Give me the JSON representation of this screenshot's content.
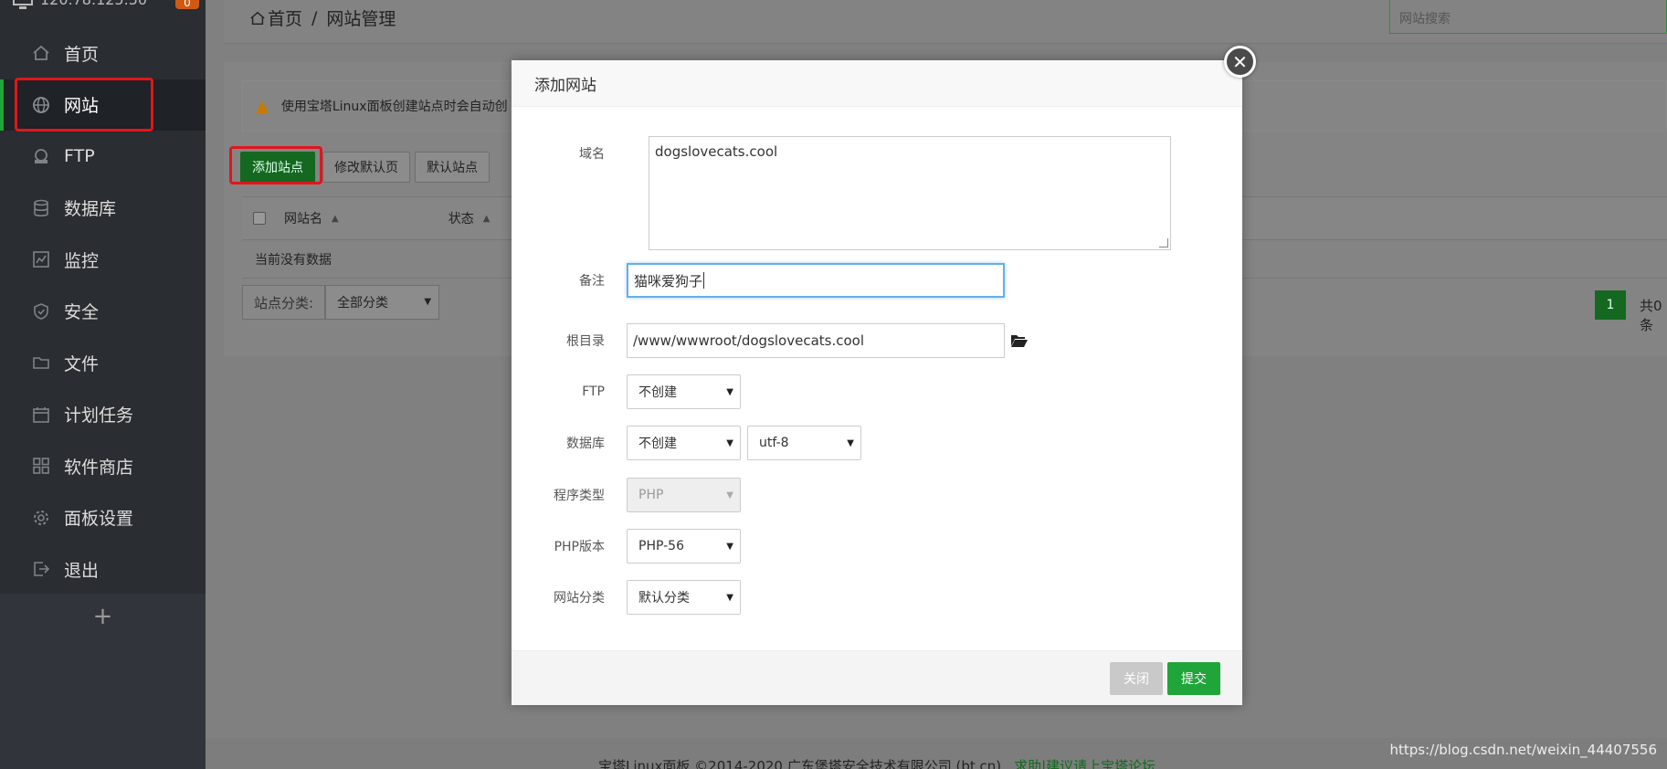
{
  "sidebar": {
    "server_ip": "120.78.125.50",
    "badge": "0",
    "items": [
      {
        "label": "首页",
        "icon": "home-icon"
      },
      {
        "label": "网站",
        "icon": "globe-icon"
      },
      {
        "label": "FTP",
        "icon": "ftp-icon"
      },
      {
        "label": "数据库",
        "icon": "database-icon"
      },
      {
        "label": "监控",
        "icon": "monitor-icon"
      },
      {
        "label": "安全",
        "icon": "shield-icon"
      },
      {
        "label": "文件",
        "icon": "folder-icon"
      },
      {
        "label": "计划任务",
        "icon": "calendar-icon"
      },
      {
        "label": "软件商店",
        "icon": "grid-icon"
      },
      {
        "label": "面板设置",
        "icon": "gear-icon"
      },
      {
        "label": "退出",
        "icon": "logout-icon"
      }
    ],
    "active_item": "网站",
    "add_symbol": "+"
  },
  "header": {
    "breadcrumb_home": "首页",
    "breadcrumb_sep": "/",
    "breadcrumb_current": "网站管理",
    "search_placeholder": "网站搜索"
  },
  "main": {
    "notice": "使用宝塔Linux面板创建站点时会自动创",
    "buttons": {
      "add_site": "添加站点",
      "edit_default_page": "修改默认页",
      "default_site": "默认站点"
    },
    "table": {
      "col_name": "网站名",
      "col_status": "状态",
      "empty": "当前没有数据"
    },
    "category_label": "站点分类:",
    "category_value": "全部分类",
    "page_current": "1",
    "page_total": "共0条"
  },
  "modal": {
    "title": "添加网站",
    "fields": {
      "domain_label": "域名",
      "domain_value": "dogslovecats.cool",
      "remark_label": "备注",
      "remark_value": "猫咪爱狗子",
      "root_label": "根目录",
      "root_value": "/www/wwwroot/dogslovecats.cool",
      "ftp_label": "FTP",
      "ftp_value": "不创建",
      "db_label": "数据库",
      "db_value": "不创建",
      "db_charset": "utf-8",
      "program_label": "程序类型",
      "program_value": "PHP",
      "php_label": "PHP版本",
      "php_value": "PHP-56",
      "category_label": "网站分类",
      "category_value": "默认分类"
    },
    "close_label": "关闭",
    "submit_label": "提交"
  },
  "footer": {
    "copyright": "宝塔Linux面板 ©2014-2020 广东堡塔安全技术有限公司 (bt.cn)",
    "link": "求助|建议请上宝塔论坛"
  },
  "watermark": "https://blog.csdn.net/weixin_44407556",
  "colors": {
    "accent_green": "#20a53a",
    "highlight_red": "#e0161b",
    "sidebar_bg": "#2a2d31"
  }
}
